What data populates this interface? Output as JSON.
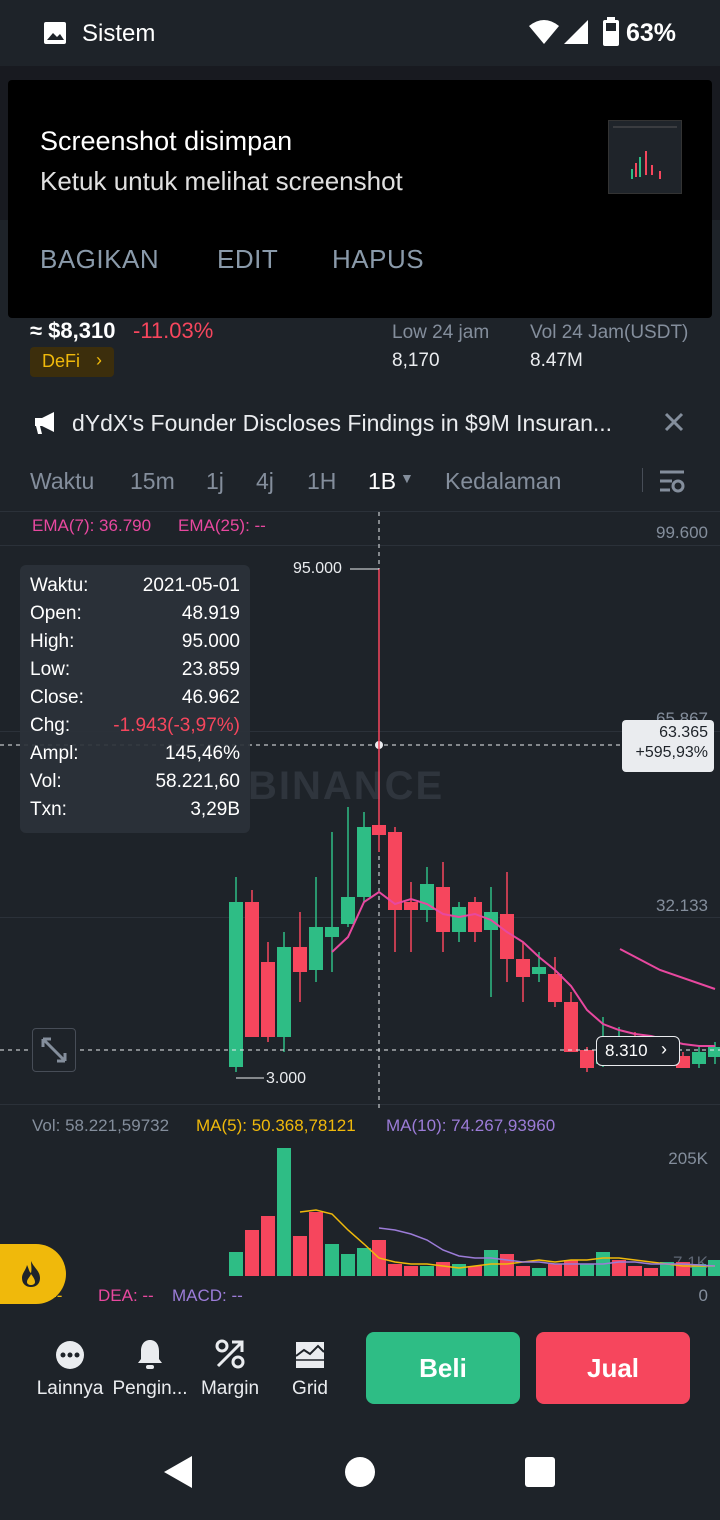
{
  "status": {
    "app_label": "Sistem",
    "battery": "63%"
  },
  "notification": {
    "title": "Screenshot disimpan",
    "subtitle": "Ketuk untuk melihat screenshot",
    "actions": [
      "BAGIKAN",
      "EDIT",
      "HAPUS"
    ]
  },
  "ticker": {
    "price": "≈ $8,310",
    "change": "-11.03%",
    "tag": "DeFi",
    "low_label": "Low 24 jam",
    "low_value": "8,170",
    "vol_label": "Vol 24 Jam(USDT)",
    "vol_value": "8.47M"
  },
  "news": {
    "text": "dYdX's Founder Discloses Findings in $9M Insuran..."
  },
  "tabs": [
    "Waktu",
    "15m",
    "1j",
    "4j",
    "1H",
    "1B",
    "Kedalaman"
  ],
  "active_tab": "1B",
  "chart": {
    "ema7": "EMA(7): 36.790",
    "ema25": "EMA(25): --",
    "axis": [
      "99.600",
      "65.867",
      "32.133"
    ],
    "high_label": "95.000",
    "low_label": "3.000",
    "watermark": "BINANCE",
    "crosshair_price": "63.365",
    "crosshair_pct": "+595,93%",
    "current_price": "8.310"
  },
  "infobox": [
    {
      "k": "Waktu:",
      "v": "2021-05-01"
    },
    {
      "k": "Open:",
      "v": "48.919"
    },
    {
      "k": "High:",
      "v": "95.000"
    },
    {
      "k": "Low:",
      "v": "23.859"
    },
    {
      "k": "Close:",
      "v": "46.962"
    },
    {
      "k": "Chg:",
      "v": "-1.943(-3,97%)"
    },
    {
      "k": "Ampl:",
      "v": "145,46%"
    },
    {
      "k": "Vol:",
      "v": "58.221,60"
    },
    {
      "k": "Txn:",
      "v": "3,29B"
    }
  ],
  "volume": {
    "vol": "Vol: 58.221,59732",
    "ma5": "MA(5): 50.368,78121",
    "ma10": "MA(10): 74.267,93960",
    "axis_top": "205K",
    "axis_mid": "7.1K",
    "axis_zero": "0"
  },
  "macd": {
    "dif": "-: --",
    "dea": "DEA: --",
    "macd": "MACD: --"
  },
  "bottom": {
    "items": [
      "Lainnya",
      "Pengin...",
      "Margin",
      "Grid"
    ],
    "buy": "Beli",
    "sell": "Jual"
  },
  "colors": {
    "up": "#2ebd85",
    "down": "#f6465d",
    "bg": "#1e2329",
    "accent": "#f0b90b"
  }
}
